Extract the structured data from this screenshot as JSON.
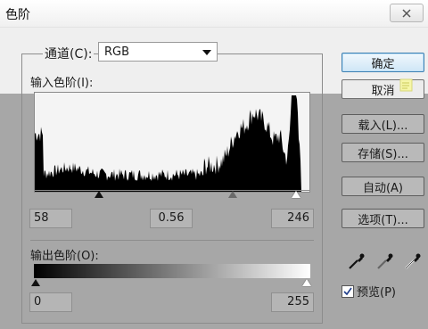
{
  "window": {
    "title": "色阶",
    "close_glyph": "✕"
  },
  "channel": {
    "label": "通道(C):",
    "value": "RGB"
  },
  "input_levels": {
    "label": "输入色阶(I):",
    "black": "58",
    "gamma": "0.56",
    "white": "246"
  },
  "output_levels": {
    "label": "输出色阶(O):",
    "black": "0",
    "white": "255"
  },
  "buttons": {
    "ok": "确定",
    "cancel": "取消",
    "load": "载入(L)...",
    "save": "存储(S)...",
    "auto": "自动(A)",
    "options": "选项(T)..."
  },
  "preview": {
    "label": "预览(P)",
    "checked": true
  },
  "icons": [
    "close-icon",
    "dropdown-arrow-icon",
    "black-eyedropper-icon",
    "gray-eyedropper-icon",
    "white-eyedropper-icon",
    "checkmark-icon",
    "cursor-icon"
  ],
  "colors": {
    "default_button": "#cfe6f6",
    "histogram": "#000000"
  }
}
